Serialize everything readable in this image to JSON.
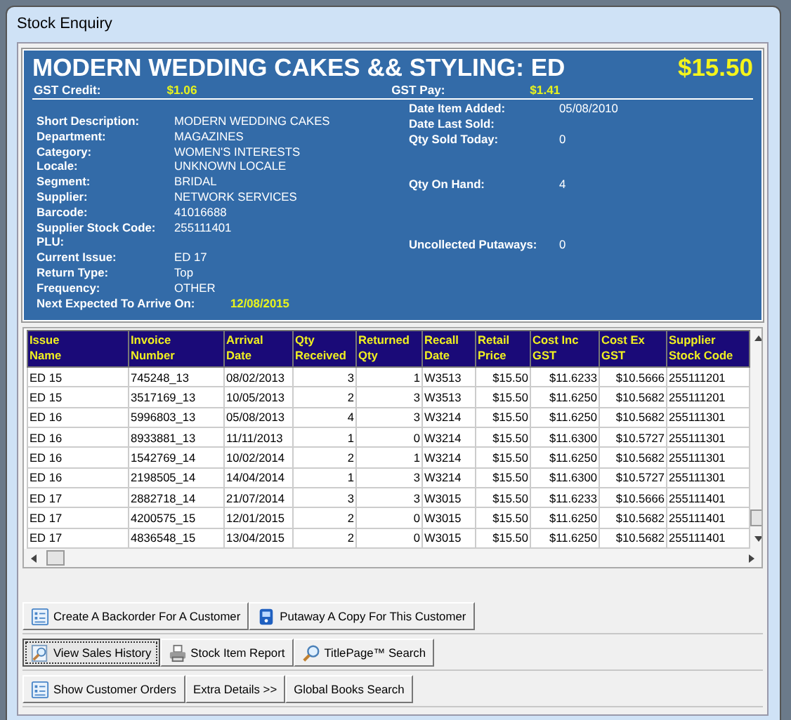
{
  "window": {
    "title": "Stock Enquiry"
  },
  "header": {
    "title": "MODERN WEDDING CAKES && STYLING: ED",
    "price": "$15.50",
    "gst_credit_label": "GST Credit:",
    "gst_credit": "$1.06",
    "gst_pay_label": "GST Pay:",
    "gst_pay": "$1.41"
  },
  "details": [
    {
      "label": "Short Description:",
      "value": "MODERN WEDDING CAKES"
    },
    {
      "label": "Department:",
      "value": "MAGAZINES"
    },
    {
      "label": "Category:",
      "value": "WOMEN'S INTERESTS"
    },
    {
      "label": "Locale:",
      "value": "UNKNOWN LOCALE"
    },
    {
      "label": "Segment:",
      "value": "BRIDAL"
    },
    {
      "label": "Supplier:",
      "value": "NETWORK SERVICES"
    },
    {
      "label": "Barcode:",
      "value": "41016688"
    },
    {
      "label": "Supplier Stock Code:",
      "value": "255111401"
    },
    {
      "label": "PLU:"
    },
    {
      "label": "Current Issue:",
      "value": "ED 17"
    },
    {
      "label": "Return Type:",
      "value": "Top"
    },
    {
      "label": "Frequency:",
      "value": "OTHER"
    }
  ],
  "next_expected": {
    "label": "Next Expected To Arrive On:",
    "value": "12/08/2015"
  },
  "stats": [
    {
      "label": "Date Item Added:",
      "value": "05/08/2010"
    },
    {
      "label": "Date Last Sold:"
    },
    {
      "label": "Qty Sold Today:",
      "value": "0"
    },
    {
      "label": "Qty On Hand:",
      "value": "4"
    },
    {
      "label": "Uncollected Putaways:",
      "value": "0"
    }
  ],
  "table": {
    "columns": [
      "Issue Name",
      "Invoice Number",
      "Arrival Date",
      "Qty Received",
      "Returned Qty",
      "Recall Date",
      "Retail Price",
      "Cost Inc GST",
      "Cost Ex GST",
      "Supplier Stock Code"
    ],
    "rows": [
      [
        "ED 15",
        "745248_13",
        "08/02/2013",
        "3",
        "1",
        "W3513",
        "$15.50",
        "$11.6233",
        "$10.5666",
        "255111201"
      ],
      [
        "ED 15",
        "3517169_13",
        "10/05/2013",
        "2",
        "3",
        "W3513",
        "$15.50",
        "$11.6250",
        "$10.5682",
        "255111201"
      ],
      [
        "ED 16",
        "5996803_13",
        "05/08/2013",
        "4",
        "3",
        "W3214",
        "$15.50",
        "$11.6250",
        "$10.5682",
        "255111301"
      ],
      [
        "ED 16",
        "8933881_13",
        "11/11/2013",
        "1",
        "0",
        "W3214",
        "$15.50",
        "$11.6300",
        "$10.5727",
        "255111301"
      ],
      [
        "ED 16",
        "1542769_14",
        "10/02/2014",
        "2",
        "1",
        "W3214",
        "$15.50",
        "$11.6250",
        "$10.5682",
        "255111301"
      ],
      [
        "ED 16",
        "2198505_14",
        "14/04/2014",
        "1",
        "3",
        "W3214",
        "$15.50",
        "$11.6300",
        "$10.5727",
        "255111301"
      ],
      [
        "ED 17",
        "2882718_14",
        "21/07/2014",
        "3",
        "3",
        "W3015",
        "$15.50",
        "$11.6233",
        "$10.5666",
        "255111401"
      ],
      [
        "ED 17",
        "4200575_15",
        "12/01/2015",
        "2",
        "0",
        "W3015",
        "$15.50",
        "$11.6250",
        "$10.5682",
        "255111401"
      ],
      [
        "ED 17",
        "4836548_15",
        "13/04/2015",
        "2",
        "0",
        "W3015",
        "$15.50",
        "$11.6250",
        "$10.5682",
        "255111401"
      ]
    ]
  },
  "button_rows": [
    [
      {
        "label": "Create A Backorder For A Customer",
        "kind": "list",
        "selected": false
      },
      {
        "label": "Putaway A Copy For This Customer",
        "kind": "phone",
        "selected": false
      }
    ],
    [
      {
        "label": "View Sales History",
        "kind": "magnifier",
        "selected": true
      },
      {
        "label": "Stock Item Report",
        "kind": "printer",
        "selected": false
      },
      {
        "label": "TitlePage™ Search",
        "kind": "search",
        "selected": false
      }
    ],
    [
      {
        "label": "Show Customer Orders",
        "kind": "list",
        "selected": false
      },
      {
        "label": "Extra Details >>",
        "selected": false
      },
      {
        "label": "Global Books Search",
        "selected": false
      }
    ]
  ]
}
